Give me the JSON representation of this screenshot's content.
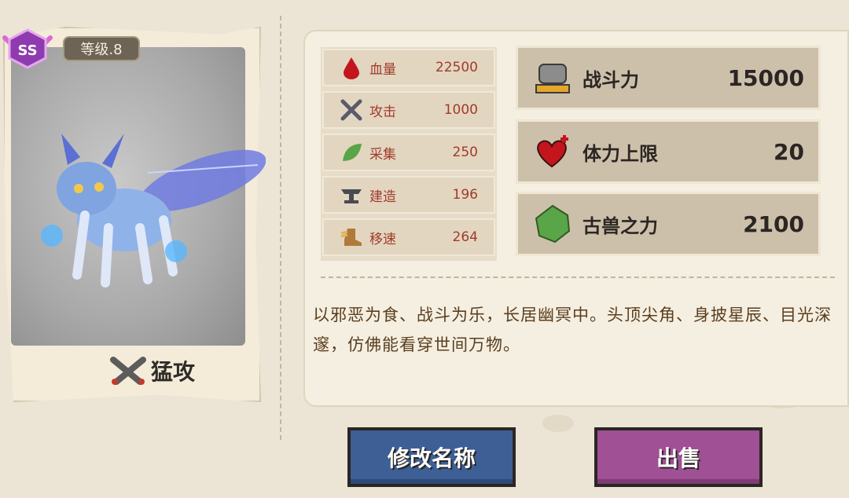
{
  "pet": {
    "rank": "SS",
    "level": "等级.8",
    "skill": "猛攻"
  },
  "stats": [
    {
      "icon": "blood-drop-icon",
      "label": "血量",
      "value": "22500"
    },
    {
      "icon": "crossed-swords-icon",
      "label": "攻击",
      "value": "1000"
    },
    {
      "icon": "leaf-icon",
      "label": "采集",
      "value": "250"
    },
    {
      "icon": "anvil-icon",
      "label": "建造",
      "value": "196"
    },
    {
      "icon": "winged-boot-icon",
      "label": "移速",
      "value": "264"
    }
  ],
  "summary": [
    {
      "icon": "fist-icon",
      "label": "战斗力",
      "value": "15000"
    },
    {
      "icon": "heart-plus-icon",
      "label": "体力上限",
      "value": "20"
    },
    {
      "icon": "green-gem-icon",
      "label": "古兽之力",
      "value": "2100"
    }
  ],
  "description": "以邪恶为食、战斗为乐，长居幽冥中。头顶尖角、身披星辰、目光深邃，仿佛能看穿世间万物。",
  "buttons": {
    "rename": "修改名称",
    "sell": "出售"
  },
  "colors": {
    "stat_text": "#a23a2c",
    "rename_button": "#3d5f95",
    "sell_button": "#a05094"
  }
}
